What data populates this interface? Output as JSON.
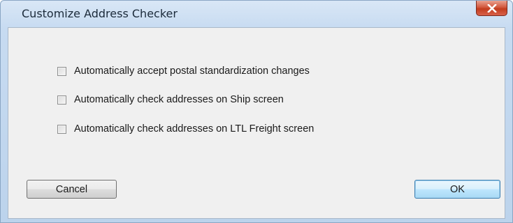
{
  "window": {
    "title": "Customize Address Checker"
  },
  "options": [
    {
      "label": "Automatically accept postal standardization changes",
      "checked": false
    },
    {
      "label": "Automatically check addresses on Ship screen",
      "checked": false
    },
    {
      "label": "Automatically check addresses on LTL Freight screen",
      "checked": false
    }
  ],
  "buttons": {
    "cancel_label": "Cancel",
    "ok_label": "OK"
  },
  "icons": {
    "close": "close-icon"
  },
  "colors": {
    "close_button": "#c84a2e",
    "ok_button_border": "#3c7fb1",
    "frame": "#c7dbf1"
  }
}
